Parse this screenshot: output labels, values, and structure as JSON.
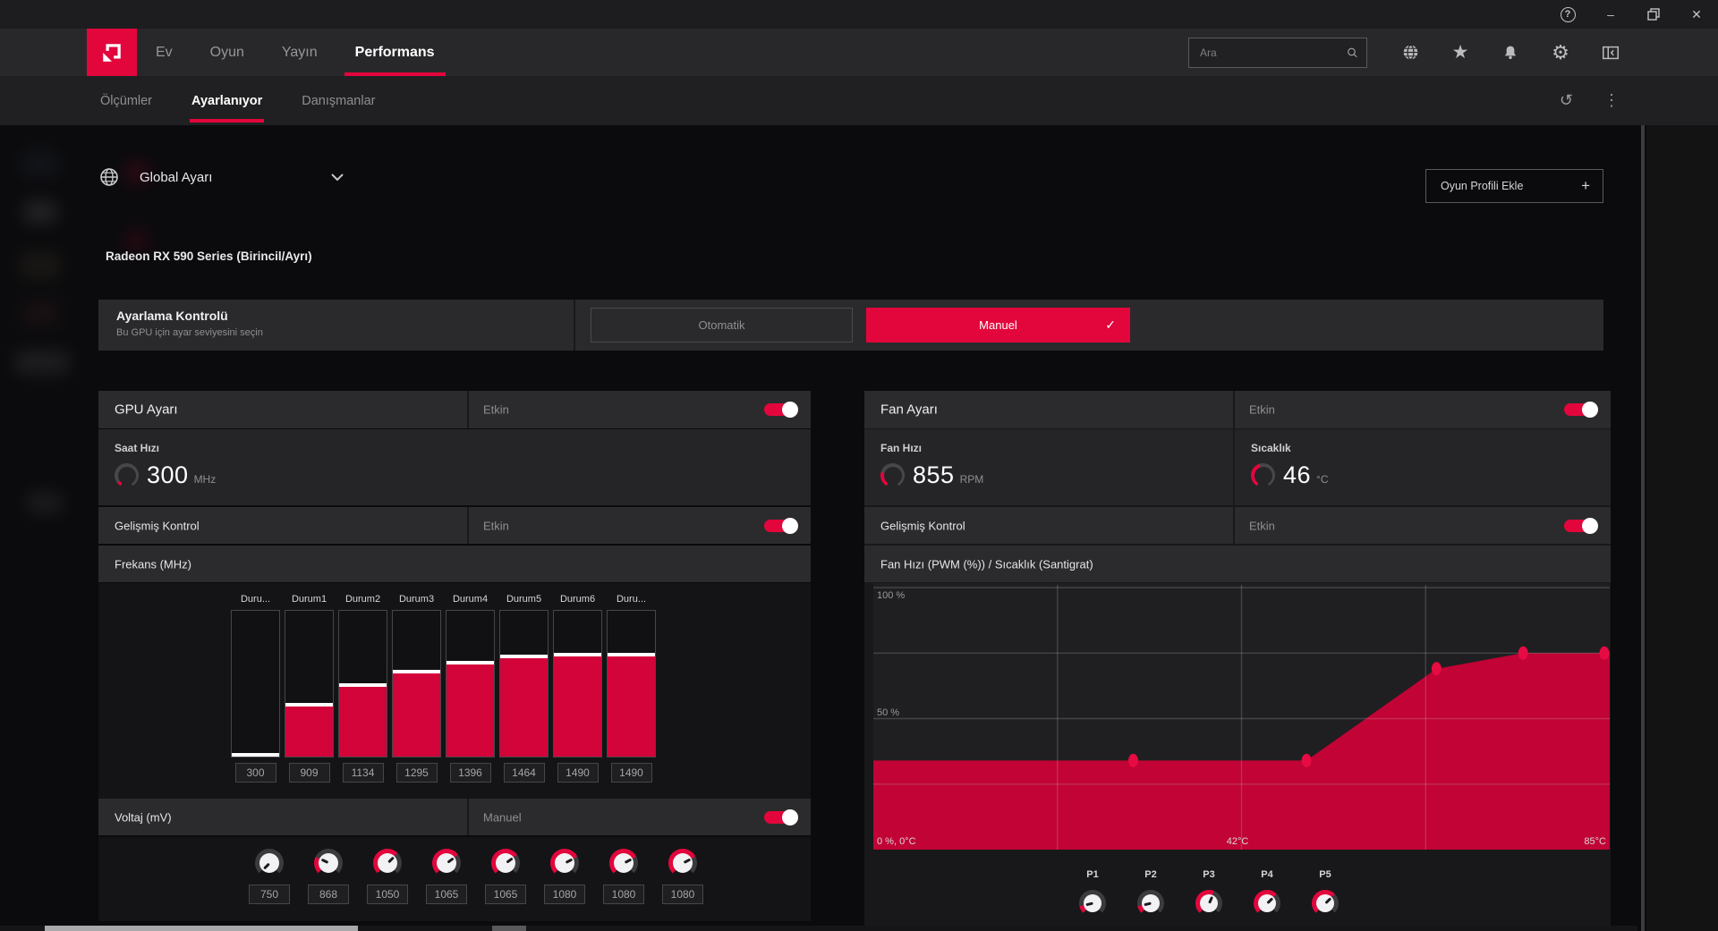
{
  "colors": {
    "accent": "#e2063c",
    "chart_fill": "#c10335",
    "chart_dot": "#e60b42"
  },
  "icons": {
    "help": "?",
    "minimize": "–",
    "close": "✕",
    "reset": "↺",
    "kebab": "⋮",
    "check": "✓",
    "plus": "+",
    "gear": "⚙",
    "star": "★"
  },
  "nav": {
    "tabs": [
      "Ev",
      "Oyun",
      "Yayın",
      "Performans"
    ],
    "active_tab": "Performans",
    "search_placeholder": "Ara"
  },
  "subnav": {
    "tabs": [
      "Ölçümler",
      "Ayarlanıyor",
      "Danışmanlar"
    ],
    "active_tab": "Ayarlanıyor"
  },
  "profile": {
    "selector_label": "Global Ayarı",
    "add_button_label": "Oyun Profili Ekle"
  },
  "gpu_name": "Radeon RX 590 Series (Birincil/Ayrı)",
  "tuning_control": {
    "title": "Ayarlama Kontrolü",
    "subtitle": "Bu GPU için ayar seviyesini seçin",
    "auto_label": "Otomatik",
    "manual_label": "Manuel"
  },
  "gpu_panel": {
    "title": "GPU Ayarı",
    "enabled_label": "Etkin",
    "clock": {
      "label": "Saat Hızı",
      "value": "300",
      "unit": "MHz",
      "gauge_pct": 7
    },
    "advanced": {
      "label": "Gelişmiş Kontrol",
      "state": "Etkin"
    },
    "frequency_label": "Frekans (MHz)",
    "voltage": {
      "label": "Voltaj (mV)",
      "state": "Manuel",
      "values": [
        750,
        868,
        1050,
        1065,
        1065,
        1080,
        1080,
        1080
      ],
      "knob_range": [
        750,
        1200
      ]
    }
  },
  "fan_panel": {
    "title": "Fan Ayarı",
    "enabled_label": "Etkin",
    "speed": {
      "label": "Fan Hızı",
      "value": "855",
      "unit": "RPM",
      "gauge_pct": 25
    },
    "temp": {
      "label": "Sıcaklık",
      "value": "46",
      "unit": "°C",
      "gauge_pct": 44
    },
    "advanced": {
      "label": "Gelişmiş Kontrol",
      "state": "Etkin"
    },
    "chart_header": "Fan Hızı (PWM (%)) / Sıcaklık (Santigrat)"
  },
  "chart_data": [
    {
      "type": "bar",
      "title": "Frekans (MHz)",
      "categories": [
        "Duru...",
        "Durum1",
        "Durum2",
        "Durum3",
        "Durum4",
        "Durum5",
        "Durum6",
        "Duru..."
      ],
      "values": [
        300,
        909,
        1134,
        1295,
        1396,
        1464,
        1490,
        1490
      ],
      "ylim": [
        300,
        2000
      ],
      "style": "vertical slider bars with white handle and value boxes"
    },
    {
      "type": "area",
      "title": "Fan Hızı (PWM (%)) / Sıcaklık (Santigrat)",
      "x": [
        30,
        50,
        65,
        75,
        85
      ],
      "y": [
        34,
        34,
        69,
        75,
        75
      ],
      "line_start": [
        0,
        34
      ],
      "point_labels": [
        "P1",
        "P2",
        "P3",
        "P4",
        "P5"
      ],
      "xlim": [
        0,
        85
      ],
      "ylim": [
        0,
        100
      ],
      "grid": true,
      "axis_labels": {
        "top_left": "100 %",
        "mid_left": "50 %",
        "bottom_left": "0 %, 0°C",
        "bottom_mid": "42°C",
        "bottom_right": "85°C"
      },
      "knob_range": [
        25,
        100
      ]
    }
  ]
}
